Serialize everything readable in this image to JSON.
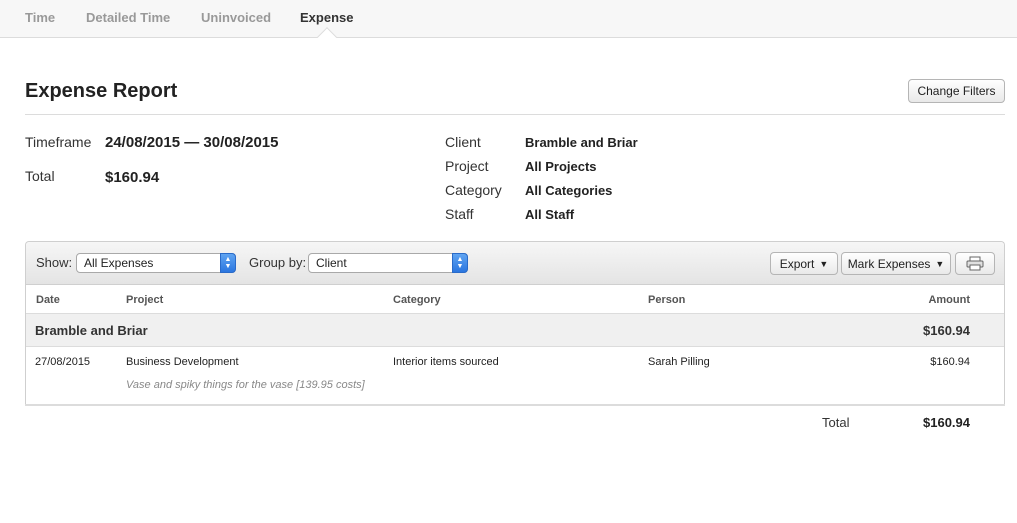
{
  "tabs": [
    {
      "label": "Time",
      "active": false
    },
    {
      "label": "Detailed Time",
      "active": false
    },
    {
      "label": "Uninvoiced",
      "active": false
    },
    {
      "label": "Expense",
      "active": true
    }
  ],
  "header": {
    "title": "Expense Report",
    "change_filters_label": "Change Filters"
  },
  "summary": {
    "timeframe_label": "Timeframe",
    "timeframe_value": "24/08/2015 — 30/08/2015",
    "total_label": "Total",
    "total_value": "$160.94",
    "client_label": "Client",
    "client_value": "Bramble and Briar",
    "project_label": "Project",
    "project_value": "All Projects",
    "category_label": "Category",
    "category_value": "All Categories",
    "staff_label": "Staff",
    "staff_value": "All Staff"
  },
  "toolbar": {
    "show_label": "Show:",
    "show_selected": "All Expenses",
    "group_label": "Group by:",
    "group_selected": "Client",
    "export_label": "Export",
    "mark_label": "Mark Expenses",
    "print_icon": "printer-icon"
  },
  "table": {
    "columns": [
      "Date",
      "Project",
      "Category",
      "Person",
      "Amount"
    ],
    "group": {
      "name": "Bramble and Briar",
      "amount": "$160.94"
    },
    "rows": [
      {
        "date": "27/08/2015",
        "project": "Business Development",
        "category": "Interior items sourced",
        "person": "Sarah Pilling",
        "amount": "$160.94",
        "note": "Vase and spiky things for the vase [139.95 costs]"
      }
    ]
  },
  "footer": {
    "total_label": "Total",
    "total_value": "$160.94"
  },
  "colors": {
    "accent_select": "#2b76e0",
    "tab_active": "#333333",
    "tab_inactive": "#999999"
  }
}
